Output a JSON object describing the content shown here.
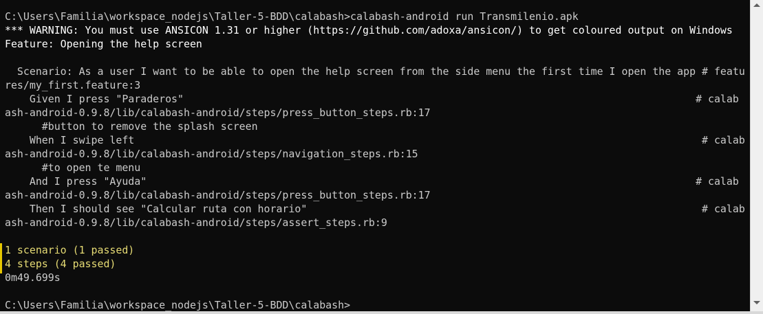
{
  "colors": {
    "background": "#0c0c0c",
    "text": "#cccccc",
    "passed": "#e6db74",
    "marker": "#e6c700"
  },
  "lines": [
    {
      "text": "C:\\Users\\Familia\\workspace_nodejs\\Taller-5-BDD\\calabash>calabash-android run Transmilenio.apk",
      "color": "#cccccc"
    },
    {
      "text": "*** WARNING: You must use ANSICON 1.31 or higher (https://github.com/adoxa/ansicon/) to get coloured output on Windows",
      "color": "#ffffff"
    },
    {
      "text": "Feature: Opening the help screen",
      "color": "#ffffff"
    },
    {
      "text": "",
      "color": "#cccccc"
    },
    {
      "text": "  Scenario: As a user I want to be able to open the help screen from the side menu the first time I open the app # featu",
      "color": "#cccccc"
    },
    {
      "text": "res/my_first.feature:3",
      "color": "#cccccc"
    },
    {
      "text": "    Given I press \"Paraderos\"                                                                                   # calab",
      "color": "#cccccc"
    },
    {
      "text": "ash-android-0.9.8/lib/calabash-android/steps/press_button_steps.rb:17",
      "color": "#cccccc"
    },
    {
      "text": "      #button to remove the splash screen",
      "color": "#cccccc"
    },
    {
      "text": "    When I swipe left                                                                                            # calab",
      "color": "#cccccc"
    },
    {
      "text": "ash-android-0.9.8/lib/calabash-android/steps/navigation_steps.rb:15",
      "color": "#cccccc"
    },
    {
      "text": "      #to open te menu",
      "color": "#cccccc"
    },
    {
      "text": "    And I press \"Ayuda\"                                                                                         # calab",
      "color": "#cccccc"
    },
    {
      "text": "ash-android-0.9.8/lib/calabash-android/steps/press_button_steps.rb:17",
      "color": "#cccccc"
    },
    {
      "text": "    Then I should see \"Calcular ruta con horario\"                                                                # calab",
      "color": "#cccccc"
    },
    {
      "text": "ash-android-0.9.8/lib/calabash-android/steps/assert_steps.rb:9",
      "color": "#cccccc"
    },
    {
      "text": "",
      "color": "#cccccc"
    },
    {
      "text": "1 scenario (1 passed)",
      "color": "#e6db74"
    },
    {
      "text": "4 steps (4 passed)",
      "color": "#e6db74"
    },
    {
      "text": "0m49.699s",
      "color": "#cccccc"
    },
    {
      "text": "",
      "color": "#cccccc"
    },
    {
      "text": "C:\\Users\\Familia\\workspace_nodejs\\Taller-5-BDD\\calabash>",
      "color": "#cccccc"
    }
  ]
}
